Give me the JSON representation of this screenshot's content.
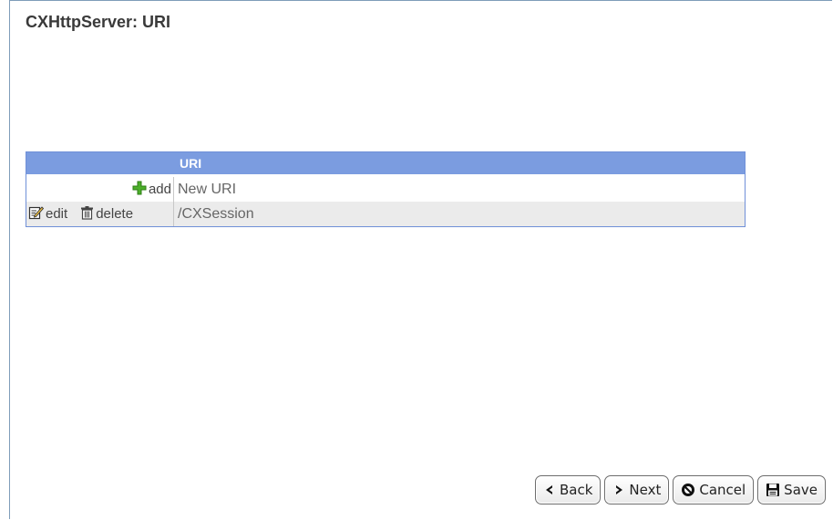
{
  "page": {
    "title": "CXHttpServer: URI"
  },
  "grid": {
    "header": {
      "uri": "URI"
    },
    "add_row": {
      "action_label": "add",
      "value": "New URI"
    },
    "rows": [
      {
        "edit_label": "edit",
        "delete_label": "delete",
        "value": "/CXSession"
      }
    ]
  },
  "buttons": {
    "back": "Back",
    "next": "Next",
    "cancel": "Cancel",
    "save": "Save"
  },
  "colors": {
    "header_bg": "#7b9ce0",
    "grid_border": "#7090d8",
    "add_icon": "#44aa22"
  },
  "icons": {
    "add": "plus-icon",
    "edit": "edit-icon",
    "delete": "trash-icon",
    "back": "chevron-left-icon",
    "next": "chevron-right-icon",
    "cancel": "prohibit-icon",
    "save": "floppy-disk-icon"
  }
}
